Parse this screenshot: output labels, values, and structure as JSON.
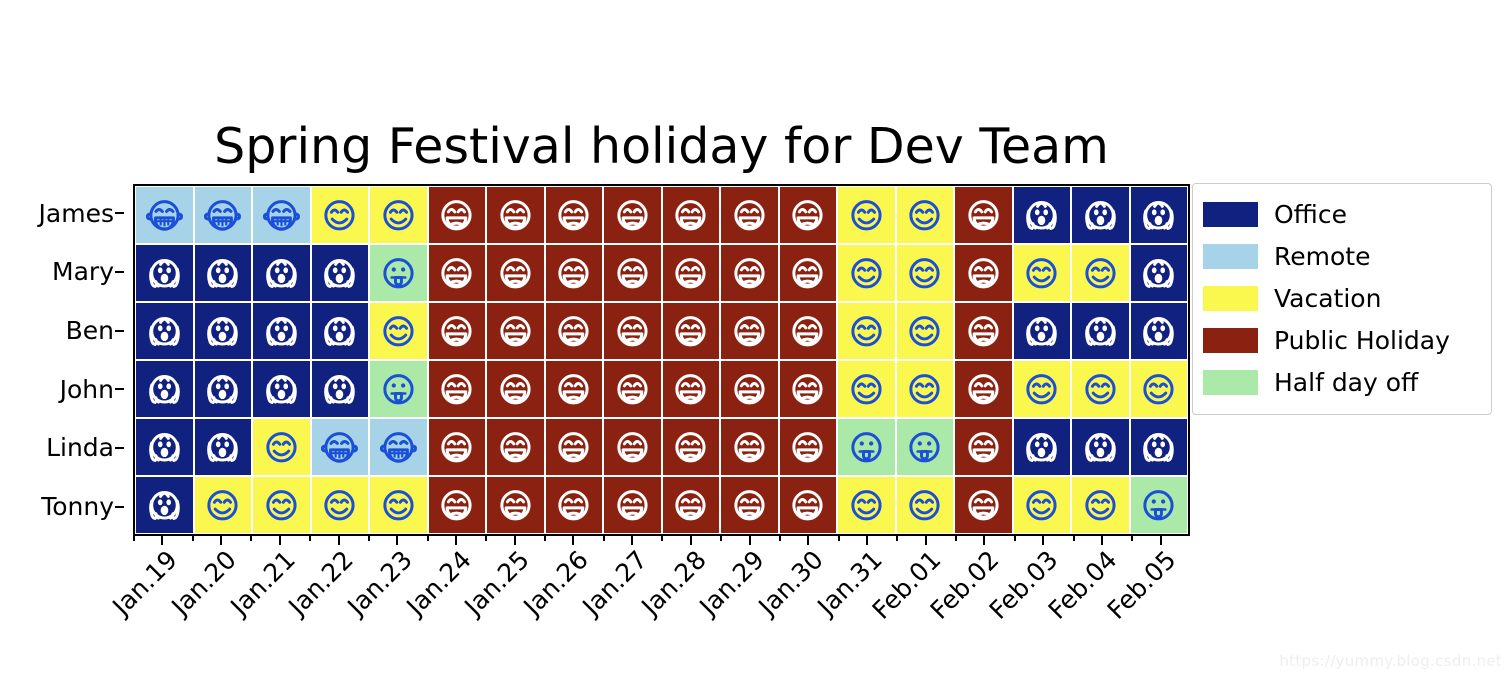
{
  "title": "Spring Festival holiday for Dev Team",
  "watermark": "https://yummy.blog.csdn.net",
  "colors": {
    "office": "#11217f",
    "remote": "#a6d3e8",
    "vacation": "#faf84f",
    "public_holiday": "#8b2110",
    "half_day": "#aae9a8",
    "glyph_blue": "#1b4fd8",
    "glyph_white": "#ffffff",
    "axis": "#000000",
    "background": "#ffffff"
  },
  "legend": {
    "position": "right",
    "items": [
      {
        "label": "Office",
        "color": "#11217f",
        "key": "office"
      },
      {
        "label": "Remote",
        "color": "#a6d3e8",
        "key": "remote"
      },
      {
        "label": "Vacation",
        "color": "#faf84f",
        "key": "vacation"
      },
      {
        "label": "Public Holiday",
        "color": "#8b2110",
        "key": "public_holiday"
      },
      {
        "label": "Half day off",
        "color": "#aae9a8",
        "key": "half_day"
      }
    ]
  },
  "chart_data": {
    "type": "heatmap",
    "title": "Spring Festival holiday for Dev Team",
    "xlabel": "",
    "ylabel": "",
    "grid": false,
    "legend_position": "right",
    "categories": [
      "Jan.19",
      "Jan.20",
      "Jan.21",
      "Jan.22",
      "Jan.23",
      "Jan.24",
      "Jan.25",
      "Jan.26",
      "Jan.27",
      "Jan.28",
      "Jan.29",
      "Jan.30",
      "Jan.31",
      "Feb.01",
      "Feb.02",
      "Feb.03",
      "Feb.04",
      "Feb.05"
    ],
    "rows": [
      "James",
      "Mary",
      "Ben",
      "John",
      "Linda",
      "Tonny"
    ],
    "status_legend": {
      "office": "Office",
      "remote": "Remote",
      "vacation": "Vacation",
      "public_holiday": "Public Holiday",
      "half_day": "Half day off"
    },
    "status_icons": {
      "office": "scream-face-icon",
      "remote": "grinning-teeth-face-icon",
      "vacation": "smiling-face-icon",
      "public_holiday": "laughing-open-mouth-face-icon",
      "half_day": "tongue-out-face-icon"
    },
    "series": [
      {
        "name": "James",
        "values": [
          "remote",
          "remote",
          "remote",
          "vacation",
          "vacation",
          "public_holiday",
          "public_holiday",
          "public_holiday",
          "public_holiday",
          "public_holiday",
          "public_holiday",
          "public_holiday",
          "vacation",
          "vacation",
          "public_holiday",
          "office",
          "office",
          "office"
        ]
      },
      {
        "name": "Mary",
        "values": [
          "office",
          "office",
          "office",
          "office",
          "half_day",
          "public_holiday",
          "public_holiday",
          "public_holiday",
          "public_holiday",
          "public_holiday",
          "public_holiday",
          "public_holiday",
          "vacation",
          "vacation",
          "public_holiday",
          "vacation",
          "vacation",
          "office"
        ]
      },
      {
        "name": "Ben",
        "values": [
          "office",
          "office",
          "office",
          "office",
          "vacation",
          "public_holiday",
          "public_holiday",
          "public_holiday",
          "public_holiday",
          "public_holiday",
          "public_holiday",
          "public_holiday",
          "vacation",
          "vacation",
          "public_holiday",
          "office",
          "office",
          "office"
        ]
      },
      {
        "name": "John",
        "values": [
          "office",
          "office",
          "office",
          "office",
          "half_day",
          "public_holiday",
          "public_holiday",
          "public_holiday",
          "public_holiday",
          "public_holiday",
          "public_holiday",
          "public_holiday",
          "vacation",
          "vacation",
          "public_holiday",
          "vacation",
          "vacation",
          "vacation"
        ]
      },
      {
        "name": "Linda",
        "values": [
          "office",
          "office",
          "vacation",
          "remote",
          "remote",
          "public_holiday",
          "public_holiday",
          "public_holiday",
          "public_holiday",
          "public_holiday",
          "public_holiday",
          "public_holiday",
          "half_day",
          "half_day",
          "public_holiday",
          "office",
          "office",
          "office"
        ]
      },
      {
        "name": "Tonny",
        "values": [
          "office",
          "vacation",
          "vacation",
          "vacation",
          "vacation",
          "public_holiday",
          "public_holiday",
          "public_holiday",
          "public_holiday",
          "public_holiday",
          "public_holiday",
          "public_holiday",
          "vacation",
          "vacation",
          "public_holiday",
          "vacation",
          "vacation",
          "half_day"
        ]
      }
    ]
  }
}
